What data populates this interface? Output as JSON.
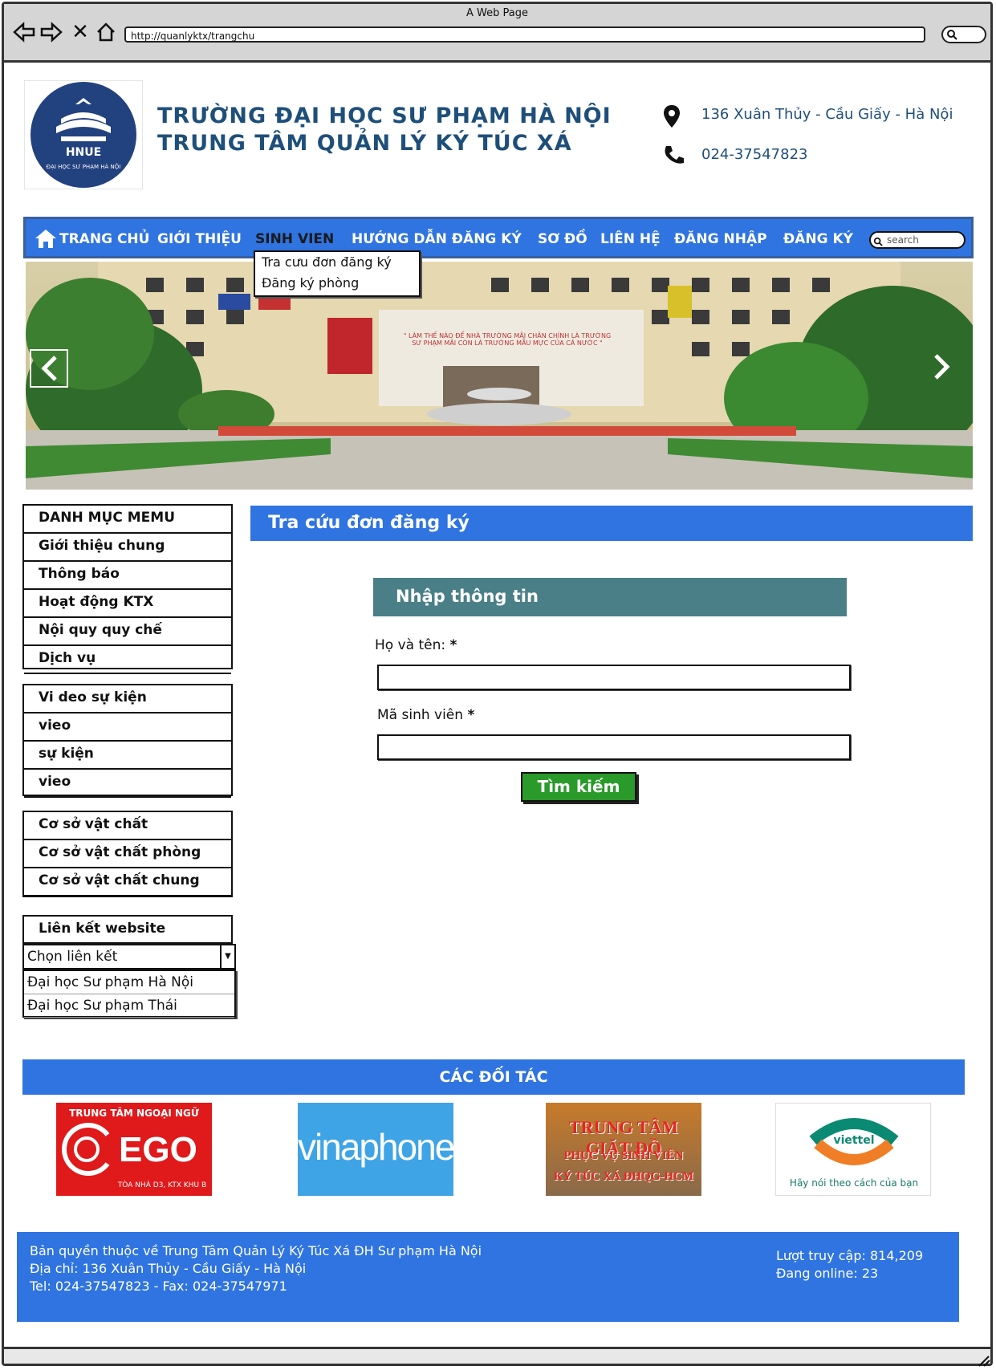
{
  "browser": {
    "title": "A Web Page",
    "url": "http://quanlyktx/trangchu",
    "icons": [
      "back-arrow-icon",
      "forward-arrow-icon",
      "close-icon",
      "home-icon",
      "search-icon"
    ]
  },
  "header": {
    "title_line1": "TRƯỜNG ĐẠI HỌC SƯ PHẠM HÀ NỘI",
    "title_line2": "TRUNG TÂM QUẢN LÝ KÝ TÚC XÁ",
    "logo_text": "HNUE",
    "logo_subtext": "ĐẠI HỌC SƯ PHẠM HÀ NỘI",
    "address": "136 Xuân Thủy - Cầu Giấy - Hà Nội",
    "phone": "024-37547823"
  },
  "nav": {
    "items": [
      "TRANG CHỦ",
      "GIỚI THIỆU",
      "SINH VIEN",
      "HƯỚNG DẪN ĐĂNG KÝ",
      "SƠ ĐỒ",
      "LIÊN HỆ",
      "ĐĂNG NHẬP",
      "ĐĂNG KÝ"
    ],
    "search_placeholder": "search",
    "dropdown": [
      "Tra cưu đơn đăng ký",
      "Đăng ký phòng"
    ]
  },
  "banner": {
    "sign_text": "\" LÀM THẾ NÀO ĐỂ NHÀ TRƯỜNG MÃI CHÂN CHÍNH LÀ TRƯỜNG SƯ PHẠM MÃI CÒN LÀ TRƯỜNG MẪU MỰC CỦA CẢ NƯỚC \""
  },
  "sidebar": {
    "menu1": [
      "DANH MỤC MEMU",
      "Giới thiệu chung",
      "Thông báo",
      "Hoạt động KTX",
      "Nội quy quy chế",
      "Dịch vụ"
    ],
    "menu2": [
      "Vi deo sự kiện",
      "vieo",
      "sự kiện",
      "vieo"
    ],
    "menu3": [
      "Cơ sở vật chất",
      "Cơ sở vật chất phòng",
      "Cơ sở vật chất chung"
    ],
    "links_title": "Liên kết website",
    "select_value": "Chọn liên kết",
    "select_options": [
      "Đại học Sư phạm Hà Nội",
      "Đại học Sư phạm Thái"
    ]
  },
  "main": {
    "heading": "Tra cứu đơn đăng ký",
    "form_heading": "Nhập thông tin",
    "name_label": "Họ và tên:",
    "student_id_label": "Mã sinh viên",
    "required_mark": "*",
    "search_button": "Tìm kiếm"
  },
  "partners": {
    "heading": "CÁC ĐỐI TÁC",
    "cego_top": "TRUNG TÂM NGOẠI NGỮ",
    "cego_name": "EGO",
    "cego_bottom": "TÒA NHÀ D3, KTX KHU B",
    "vinaphone": "vinaphone",
    "laundry_line1": "TRUNG TÂM GIẶT ĐỒ",
    "laundry_line2": "PHỤC VỤ SINH VIÊN",
    "laundry_line3": "KÝ TÚC XÁ ĐHQG-HCM",
    "viettel_name": "viettel",
    "viettel_slogan": "Hãy nói theo cách của bạn"
  },
  "footer": {
    "line1": "Bản quyền thuộc về Trung Tâm Quản Lý Ký Túc Xá ĐH Sư phạm Hà Nội",
    "line2": "Địa chỉ: 136 Xuân Thủy - Cầu Giấy - Hà Nội",
    "line3": "Tel: 024-37547823 - Fax: 024-37547971",
    "visits": "Lượt truy cập: 814,209",
    "online": "Đang online: 23"
  },
  "colors": {
    "primary_blue": "#2f74e0",
    "title_blue": "#1e4f7a",
    "form_teal": "#4a7f88",
    "button_green": "#2a9a2a"
  }
}
